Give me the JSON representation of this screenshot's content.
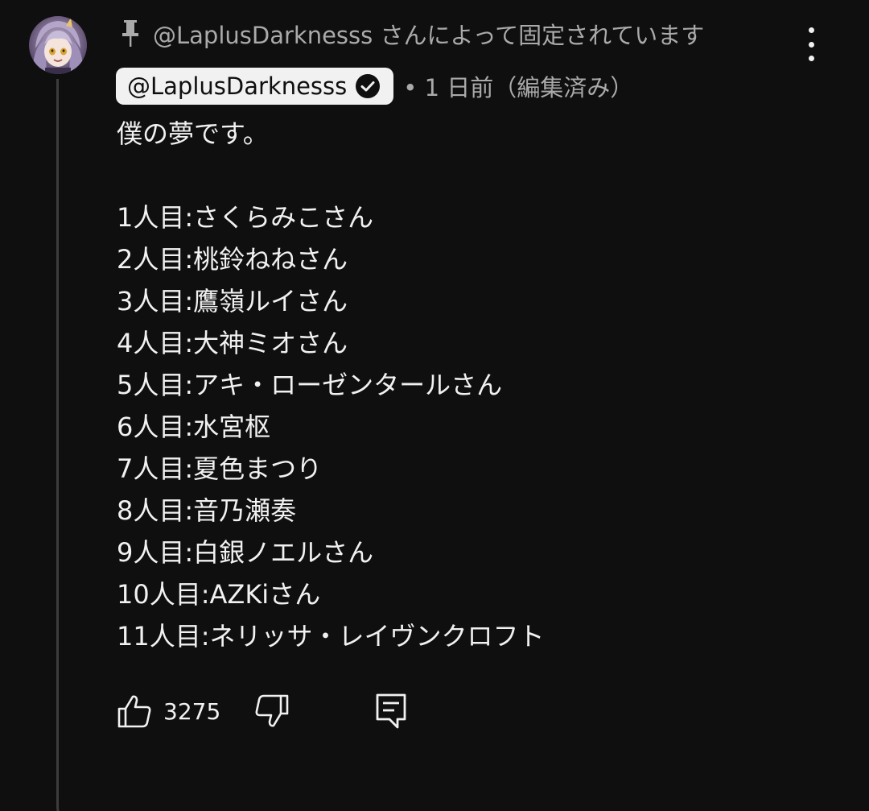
{
  "pinned": {
    "text": "@LaplusDarknesss さんによって固定されています"
  },
  "comment": {
    "author": "@LaplusDarknesss",
    "meta": "• 1 日前（編集済み）",
    "lines": [
      "僕の夢です。",
      "",
      "1人目:さくらみこさん",
      "2人目:桃鈴ねねさん",
      "3人目:鷹嶺ルイさん",
      "4人目:大神ミオさん",
      "5人目:アキ・ローゼンタールさん",
      "6人目:水宮枢",
      "7人目:夏色まつり",
      "8人目:音乃瀬奏",
      "9人目:白銀ノエルさん",
      "10人目:AZKiさん",
      "11人目:ネリッサ・レイヴンクロフト"
    ]
  },
  "actions": {
    "like_count": "3275"
  },
  "icons": {
    "pin": "pin-icon",
    "menu": "more-vert-icon",
    "verified": "verified-check-icon",
    "like": "thumbs-up-icon",
    "dislike": "thumbs-down-icon",
    "reply": "reply-comment-icon"
  }
}
